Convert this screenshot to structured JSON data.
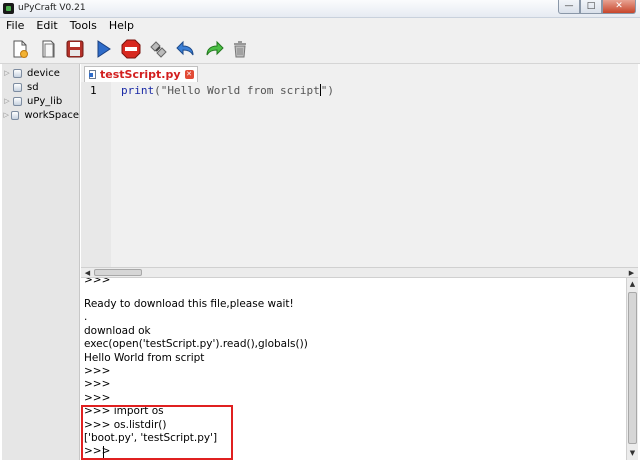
{
  "window": {
    "title": "uPyCraft V0.21",
    "controls": {
      "minimize": "—",
      "maximize": "□",
      "close": "✕"
    }
  },
  "menu": {
    "items": [
      {
        "label": "File"
      },
      {
        "label": "Edit"
      },
      {
        "label": "Tools"
      },
      {
        "label": "Help"
      }
    ]
  },
  "toolbar": {
    "icons": [
      "new-file-icon",
      "open-file-icon",
      "save-icon",
      "download-run-icon",
      "stop-icon",
      "connect-icon",
      "undo-icon",
      "redo-icon",
      "trash-icon"
    ]
  },
  "sidebar": {
    "items": [
      {
        "label": "device"
      },
      {
        "label": "sd"
      },
      {
        "label": "uPy_lib"
      },
      {
        "label": "workSpace"
      }
    ]
  },
  "editor": {
    "tab_label": "testScript.py",
    "line_number": "1",
    "code_keyword": "print",
    "code_rest": "(\"Hello World from script",
    "code_end": "\")"
  },
  "terminal": {
    "lines": [
      ">>>",
      "Ready to download this file,please wait!",
      ".",
      "download ok",
      "exec(open('testScript.py').read(),globals())",
      "Hello World from script",
      ">>>",
      ">>>",
      ">>>",
      ">>> import os",
      ">>> os.listdir()",
      "['boot.py', 'testScript.py']",
      ">>>"
    ]
  },
  "colors": {
    "tab_label": "#d21f1f",
    "highlight_box": "#e02020",
    "keyword": "#1a2aa6"
  }
}
